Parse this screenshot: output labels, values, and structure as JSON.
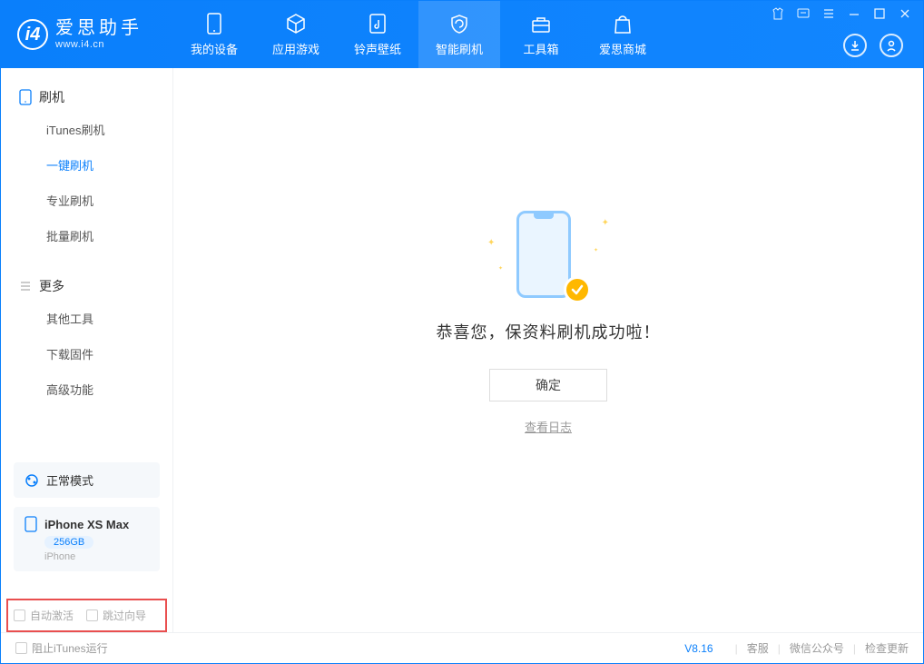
{
  "app": {
    "title": "爱思助手",
    "subtitle": "www.i4.cn"
  },
  "nav": {
    "tabs": [
      {
        "label": "我的设备"
      },
      {
        "label": "应用游戏"
      },
      {
        "label": "铃声壁纸"
      },
      {
        "label": "智能刷机"
      },
      {
        "label": "工具箱"
      },
      {
        "label": "爱思商城"
      }
    ]
  },
  "sidebar": {
    "section1_title": "刷机",
    "section1_items": [
      {
        "label": "iTunes刷机"
      },
      {
        "label": "一键刷机"
      },
      {
        "label": "专业刷机"
      },
      {
        "label": "批量刷机"
      }
    ],
    "section2_title": "更多",
    "section2_items": [
      {
        "label": "其他工具"
      },
      {
        "label": "下载固件"
      },
      {
        "label": "高级功能"
      }
    ],
    "mode_label": "正常模式",
    "device_name": "iPhone XS Max",
    "storage": "256GB",
    "device_type": "iPhone",
    "checkbox1": "自动激活",
    "checkbox2": "跳过向导"
  },
  "main": {
    "success_text": "恭喜您，保资料刷机成功啦！",
    "ok_button": "确定",
    "log_link": "查看日志"
  },
  "footer": {
    "itunes_block": "阻止iTunes运行",
    "version": "V8.16",
    "link1": "客服",
    "link2": "微信公众号",
    "link3": "检查更新"
  }
}
